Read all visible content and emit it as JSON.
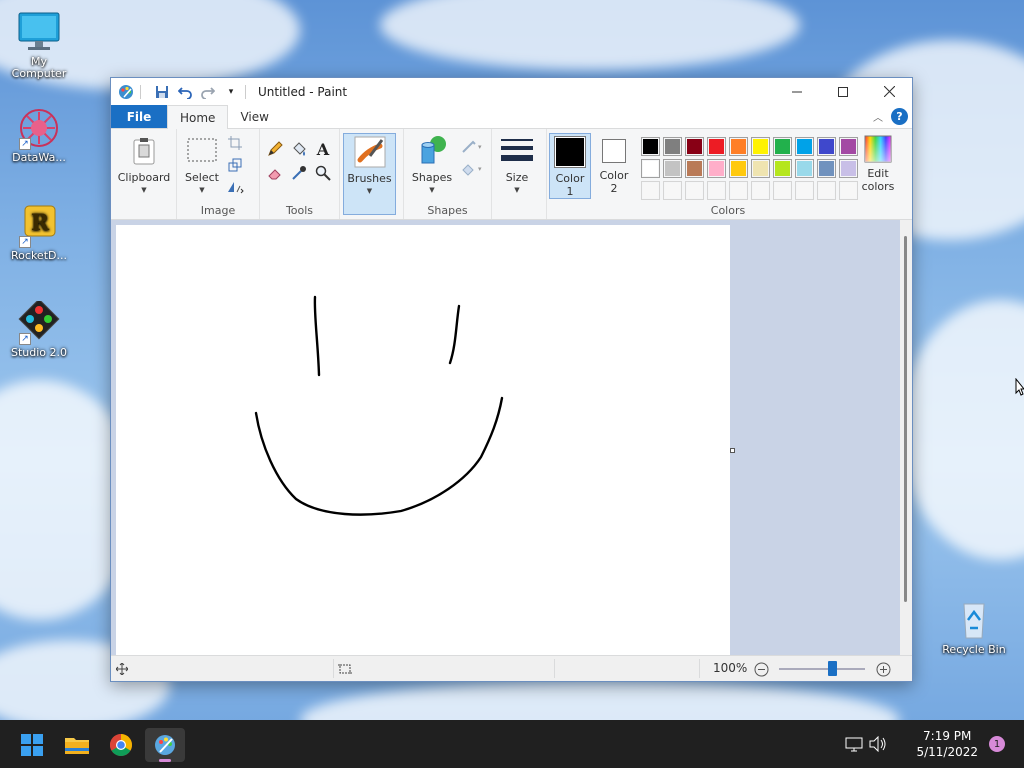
{
  "desktop": {
    "icons": [
      {
        "label": "My Computer",
        "icon": "monitor-icon"
      },
      {
        "label": "DataWa...",
        "icon": "datawatch-icon"
      },
      {
        "label": "RocketD...",
        "icon": "rocketdock-icon"
      },
      {
        "label": "Studio 2.0",
        "icon": "studio-icon"
      },
      {
        "label": "Recycle Bin",
        "icon": "recycle-bin-icon"
      }
    ]
  },
  "window": {
    "title": "Untitled - Paint",
    "tabs": {
      "file": "File",
      "home": "Home",
      "view": "View"
    },
    "help": "?"
  },
  "ribbon": {
    "clipboard": {
      "label": "Clipboard"
    },
    "image": {
      "select": "Select",
      "label": "Image"
    },
    "tools": {
      "label": "Tools",
      "text_glyph": "A"
    },
    "brushes": {
      "label": "Brushes"
    },
    "shapes": {
      "button": "Shapes",
      "label": "Shapes"
    },
    "size": {
      "label": "Size"
    },
    "color1": {
      "line1": "Color",
      "line2": "1",
      "value": "#000000"
    },
    "color2": {
      "line1": "Color",
      "line2": "2",
      "value": "#ffffff"
    },
    "colors": {
      "label": "Colors",
      "palette_row1": [
        "#000000",
        "#7f7f7f",
        "#880015",
        "#ed1c24",
        "#ff7f27",
        "#fff200",
        "#22b14c",
        "#00a2e8",
        "#3f48cc",
        "#a349a4"
      ],
      "palette_row2": [
        "#ffffff",
        "#c3c3c3",
        "#b97a57",
        "#ffaec9",
        "#ffc90e",
        "#efe4b0",
        "#b5e61d",
        "#99d9ea",
        "#7092be",
        "#c8bfe7"
      ],
      "palette_row3": [
        "#f7f7f7",
        "#f7f7f7",
        "#f7f7f7",
        "#f7f7f7",
        "#f7f7f7",
        "#f7f7f7",
        "#f7f7f7",
        "#f7f7f7",
        "#f7f7f7",
        "#f7f7f7"
      ],
      "edit_line1": "Edit",
      "edit_line2": "colors"
    }
  },
  "status": {
    "zoom": "100%",
    "zoom_level": 1.0
  },
  "taskbar": {
    "time": "7:19 PM",
    "date": "5/11/2022",
    "notifications": "1"
  }
}
